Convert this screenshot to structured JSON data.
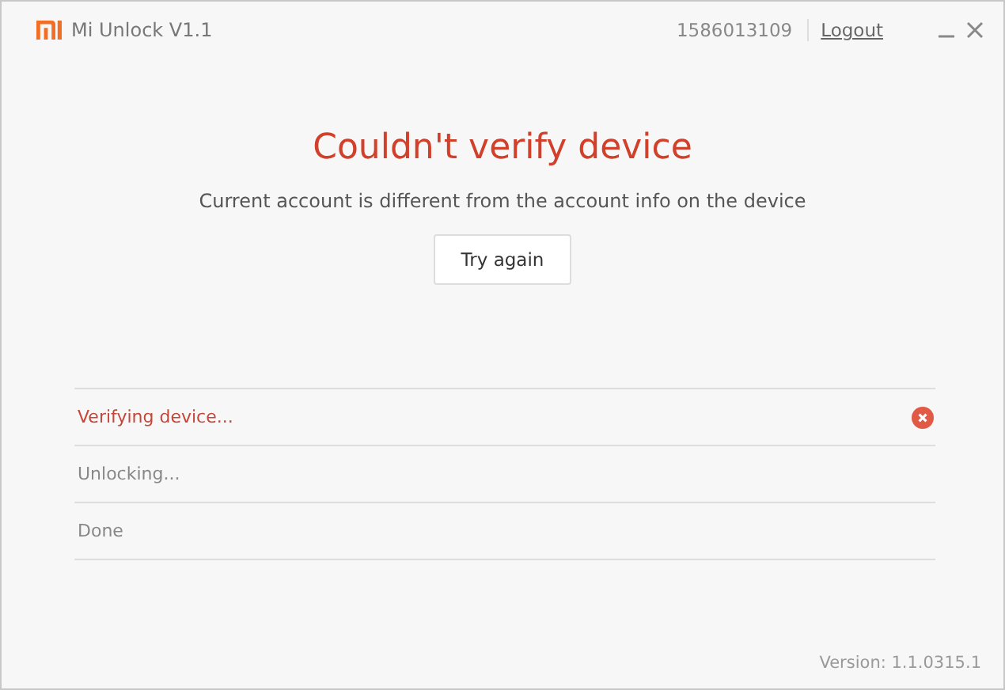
{
  "window": {
    "title": "Mi Unlock  V1.1",
    "account": "1586013109",
    "logout": "Logout"
  },
  "message": {
    "heading": "Couldn't verify device",
    "detail": "Current account is different from the account info on the device",
    "button": "Try again"
  },
  "steps": [
    {
      "label": "Verifying device...",
      "failed": true
    },
    {
      "label": "Unlocking...",
      "failed": false
    },
    {
      "label": "Done",
      "failed": false
    }
  ],
  "version": "Version: 1.1.0315.1"
}
